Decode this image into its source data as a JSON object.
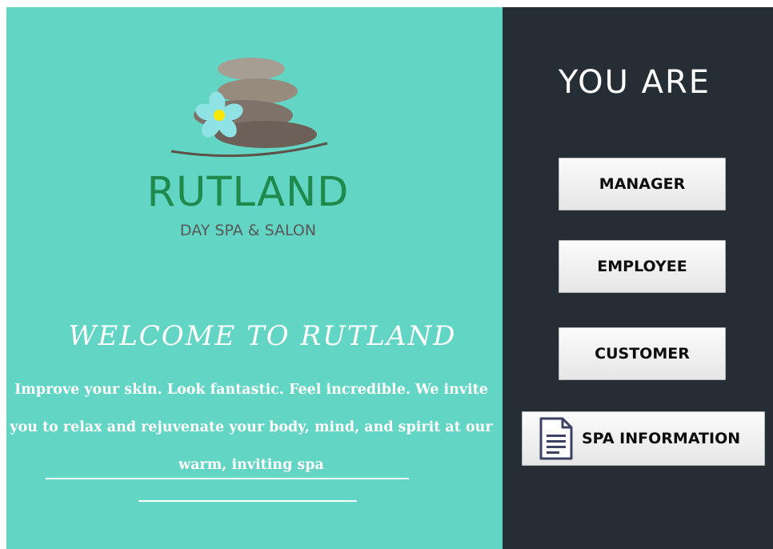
{
  "brand": {
    "name": "RUTLAND",
    "subtitle": "DAY SPA & SALON"
  },
  "welcome": {
    "heading": "WELCOME TO RUTLAND",
    "tagline": "Improve your skin. Look fantastic. Feel incredible. We invite you to relax and rejuvenate your body, mind, and spirit at our warm, inviting spa"
  },
  "roles": {
    "heading": "YOU ARE",
    "manager_label": "MANAGER",
    "employee_label": "EMPLOYEE",
    "customer_label": "CUSTOMER",
    "spa_info_label": "SPA INFORMATION"
  },
  "icons": {
    "logo": "stacked-stones-flower-logo",
    "spa_info": "document-icon"
  },
  "colors": {
    "left_panel": "#62d5c4",
    "right_panel": "#252d35",
    "brand_green": "#1f8a4c",
    "flower": "#8fe3e4",
    "flower_center": "#ffe600"
  }
}
